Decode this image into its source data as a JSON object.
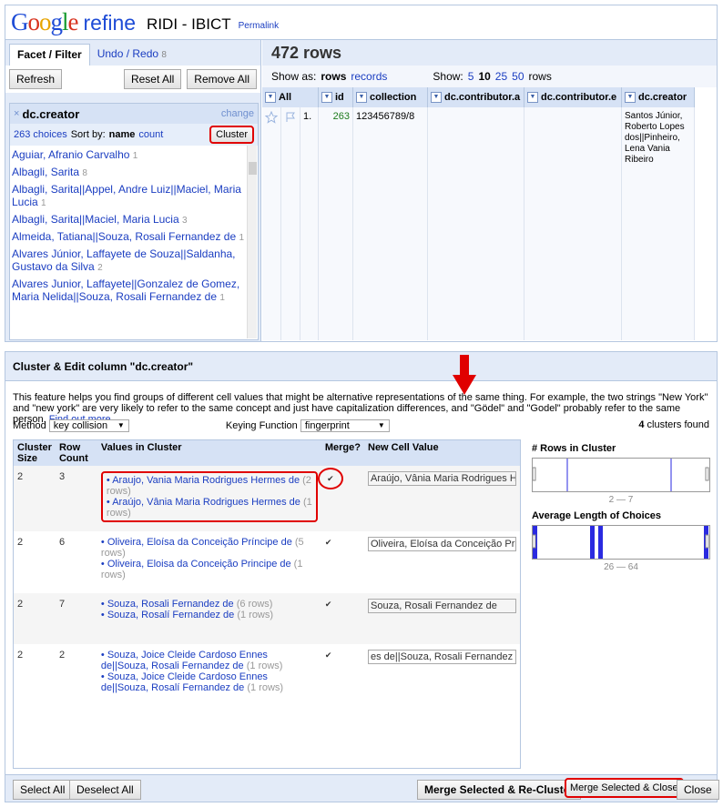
{
  "header": {
    "logo_google": "Google",
    "logo_refine": "refine",
    "project_name": "RIDI - IBICT",
    "permalink": "Permalink"
  },
  "left_panel": {
    "tab_facet": "Facet / Filter",
    "tab_undo": "Undo / Redo",
    "tab_undo_count": "8",
    "refresh": "Refresh",
    "reset_all": "Reset All",
    "remove_all": "Remove All",
    "facet": {
      "close": "×",
      "name": "dc.creator",
      "change": "change",
      "choices": "263 choices",
      "sort_by": "Sort by:",
      "sort_name": "name",
      "sort_count": "count",
      "cluster": "Cluster",
      "items": [
        {
          "label": "Aguiar, Afranio Carvalho",
          "count": "1"
        },
        {
          "label": "Albagli, Sarita",
          "count": "8"
        },
        {
          "label": "Albagli, Sarita||Appel, Andre Luiz||Maciel, Maria Lucia",
          "count": "1"
        },
        {
          "label": "Albagli, Sarita||Maciel, Maria Lucia",
          "count": "3"
        },
        {
          "label": "Almeida, Tatiana||Souza, Rosali Fernandez de",
          "count": "1"
        },
        {
          "label": "Alvares Júnior, Laffayete de Souza||Saldanha, Gustavo da Silva",
          "count": "2"
        },
        {
          "label": "Alvares Junior, Laffayete||Gonzalez de Gomez, Maria Nelida||Souza, Rosali Fernandez de",
          "count": "1"
        }
      ]
    }
  },
  "right_panel": {
    "rows_title": "472 rows",
    "show_as": "Show as:",
    "rows": "rows",
    "records": "records",
    "show": "Show:",
    "page_sizes": [
      "5",
      "10",
      "25",
      "50"
    ],
    "rows_suffix": "rows",
    "columns": [
      "All",
      "id",
      "collection",
      "dc.contributor.a",
      "dc.contributor.e",
      "dc.creator"
    ],
    "row": {
      "index": "1.",
      "id": "263",
      "collection": "123456789/8",
      "contrib_a": "",
      "contrib_e": "",
      "creator": "Santos Júnior, Roberto Lopes dos||Pinheiro, Lena Vania Ribeiro"
    }
  },
  "dialog": {
    "title": "Cluster & Edit column \"dc.creator\"",
    "description": "This feature helps you find groups of different cell values that might be alternative representations of the same thing. For example, the two strings \"New York\" and \"new york\" are very likely to refer to the same concept and just have capitalization differences, and \"Gödel\" and \"Godel\" probably refer to the same person.",
    "find_out_more": "Find out more ...",
    "method_label": "Method",
    "method_value": "key collision",
    "keying_label": "Keying Function",
    "keying_value": "fingerprint",
    "clusters_found_count": "4",
    "clusters_found_text": "clusters found",
    "headers": {
      "size": "Cluster Size",
      "count": "Row Count",
      "values": "Values in Cluster",
      "merge": "Merge?",
      "new_value": "New Cell Value"
    },
    "clusters": [
      {
        "size": "2",
        "count": "3",
        "values": [
          {
            "label": "Araujo, Vania Maria Rodrigues Hermes de",
            "rows": "(2 rows)"
          },
          {
            "label": "Araújo, Vânia Maria Rodrigues Hermes de",
            "rows": "(1 rows)"
          }
        ],
        "new_value": "Araújo, Vânia Maria Rodrigues Hen"
      },
      {
        "size": "2",
        "count": "6",
        "values": [
          {
            "label": "Oliveira, Eloísa da Conceição Príncipe de",
            "rows": "(5 rows)"
          },
          {
            "label": "Oliveira, Eloisa da Conceição Principe de",
            "rows": "(1 rows)"
          }
        ],
        "new_value": "Oliveira, Eloísa da Conceição Prínc"
      },
      {
        "size": "2",
        "count": "7",
        "values": [
          {
            "label": "Souza, Rosali Fernandez de",
            "rows": "(6 rows)"
          },
          {
            "label": "Souza, Rosalí Fernandez de",
            "rows": "(1 rows)"
          }
        ],
        "new_value": "Souza, Rosali Fernandez de"
      },
      {
        "size": "2",
        "count": "2",
        "values": [
          {
            "label": "Souza, Joice Cleide Cardoso Ennes de||Souza, Rosali Fernandez de",
            "rows": "(1 rows)"
          },
          {
            "label": "Souza, Joice Cleide Cardoso Ennes de||Souza, Rosalí Fernandez de",
            "rows": "(1 rows)"
          }
        ],
        "new_value": "es de||Souza, Rosali Fernandez de"
      }
    ],
    "rows_hist_title": "# Rows in Cluster",
    "rows_hist_range": "2 — 7",
    "len_hist_title": "Average Length of Choices",
    "len_hist_range": "26 — 64",
    "select_all": "Select All",
    "deselect_all": "Deselect All",
    "merge_recluster": "Merge Selected & Re-Cluster",
    "merge_close": "Merge Selected & Close",
    "close": "Close",
    "colors": {
      "highlight": "#e00000",
      "hist_bar": "#2a2ae0"
    }
  }
}
